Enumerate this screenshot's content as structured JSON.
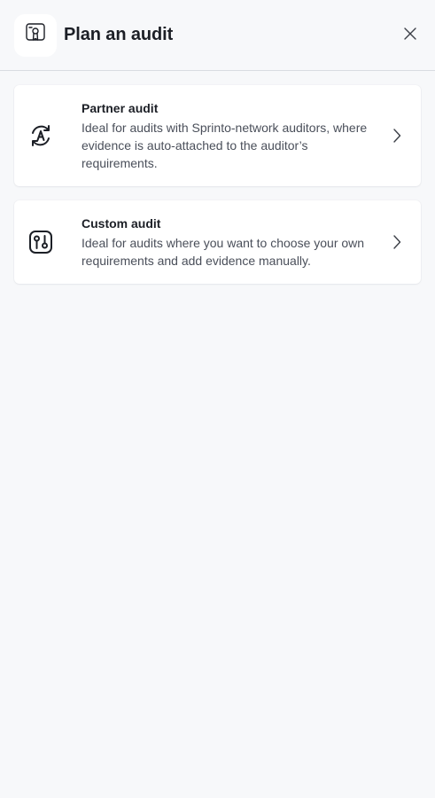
{
  "header": {
    "title": "Plan an audit",
    "icon": "certificate-icon",
    "close_icon": "close-icon"
  },
  "options": [
    {
      "title": "Partner audit",
      "description": "Ideal for audits with Sprinto-network auditors, where evidence is auto-attached to the auditor’s requirements.",
      "icon": "auto-sync-a-icon",
      "chevron_icon": "chevron-right-icon"
    },
    {
      "title": "Custom audit",
      "description": "Ideal for audits where you want to choose your own requirements and add evidence manually.",
      "icon": "custom-route-icon",
      "chevron_icon": "chevron-right-icon"
    }
  ],
  "colors": {
    "background": "#f7f8fa",
    "card": "#ffffff",
    "text_primary": "#1c1f26",
    "text_secondary": "#4a4f5a",
    "divider": "#d9dce1"
  }
}
